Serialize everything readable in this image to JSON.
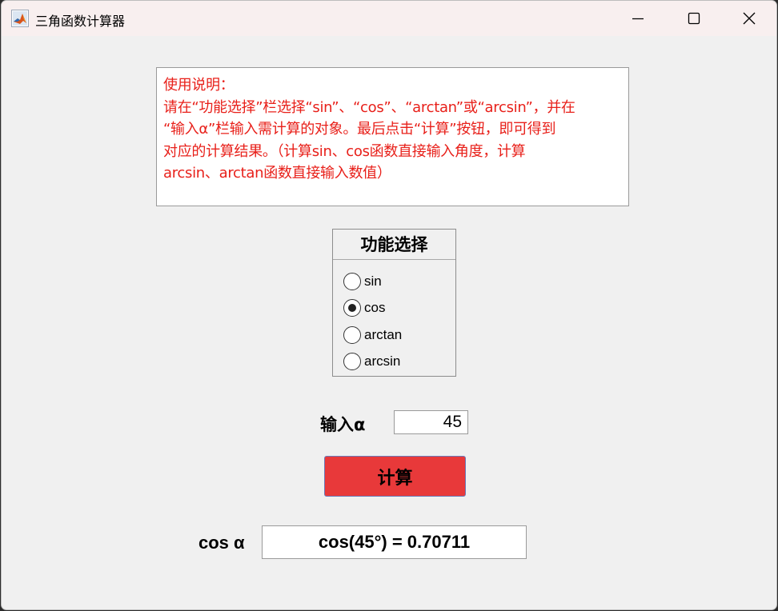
{
  "window": {
    "title": "三角函数计算器",
    "app_icon": "matlab-icon"
  },
  "instructions": {
    "lines": [
      "使用说明：",
      "请在“功能选择”栏选择“sin”、“cos”、“arctan”或“arcsin”，并在",
      "“输入α”栏输入需计算的对象。最后点击“计算”按钮，即可得到",
      "对应的计算结果。（计算sin、cos函数直接输入角度，计算",
      "arcsin、arctan函数直接输入数值）"
    ],
    "color": "#e8201a"
  },
  "function_panel": {
    "title": "功能选择",
    "options": [
      {
        "label": "sin",
        "selected": false
      },
      {
        "label": "cos",
        "selected": true
      },
      {
        "label": "arctan",
        "selected": false
      },
      {
        "label": "arcsin",
        "selected": false
      }
    ]
  },
  "input": {
    "label": "输入α",
    "value": "45"
  },
  "calculate_button": {
    "label": "计算",
    "color": "#e8393a"
  },
  "result": {
    "label": "cos α",
    "value": "cos(45°) = 0.70711"
  }
}
